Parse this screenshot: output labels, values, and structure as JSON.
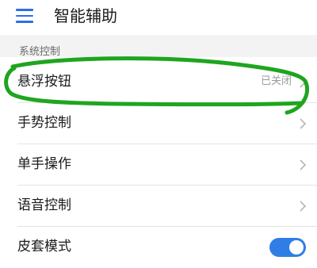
{
  "header": {
    "title": "智能辅助",
    "menu_icon": "hamburger-menu-icon"
  },
  "section": {
    "title": "系统控制"
  },
  "items": [
    {
      "label": "悬浮按钮",
      "value": "已关闭",
      "control": "chevron"
    },
    {
      "label": "手势控制",
      "control": "chevron"
    },
    {
      "label": "单手操作",
      "control": "chevron"
    },
    {
      "label": "语音控制",
      "control": "chevron"
    },
    {
      "label": "皮套模式",
      "control": "toggle",
      "enabled": true
    }
  ],
  "colors": {
    "accent": "#2f7ee6",
    "annotation": "#1fa51f"
  }
}
